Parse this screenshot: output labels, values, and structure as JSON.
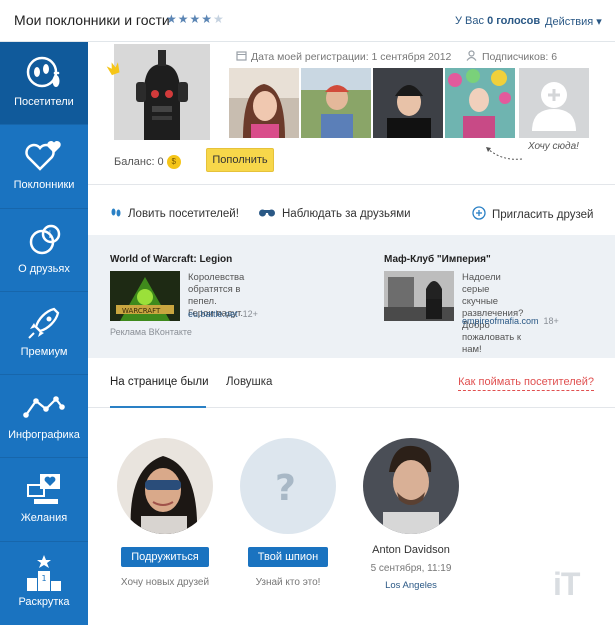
{
  "header": {
    "title": "Мои поклонники и гости",
    "stars_on": "★★★★",
    "stars_off": "★",
    "votes_prefix": "У Вас ",
    "votes_count": "0 голосов",
    "actions": "Действия ▾"
  },
  "sidebar": {
    "items": [
      {
        "label": "Посетители",
        "icon": "footprints-icon"
      },
      {
        "label": "Поклонники",
        "icon": "hearts-icon"
      },
      {
        "label": "О друзьях",
        "icon": "friends-info-icon"
      },
      {
        "label": "Премиум",
        "icon": "rocket-icon"
      },
      {
        "label": "Инфографика",
        "icon": "line-chart-icon"
      },
      {
        "label": "Желания",
        "icon": "wishes-icon"
      },
      {
        "label": "Раскрутка",
        "icon": "podium-icon"
      }
    ]
  },
  "profile": {
    "registration": "Дата моей регистрации: 1 сентября 2012",
    "subscribers": "Подписчиков: 6",
    "balance_label": "Баланс: 0",
    "coin": "$",
    "refill_button": "Пополнить",
    "want_here": "Хочу сюда!"
  },
  "actions_row": {
    "catch": "Ловить посетителей!",
    "watch": "Наблюдать за друзьями",
    "invite": "Пригласить друзей"
  },
  "ads": {
    "ad1": {
      "title": "World of Warcraft: Legion",
      "text1": "Королевства обратятся в пепел.",
      "text2": "Герои падут.",
      "url": "eu.battle.net",
      "age": "12+"
    },
    "ad2": {
      "title": "Маф-Клуб \"Империя\"",
      "text1": "Надоели серые скучные",
      "text2": "развлечения?",
      "text3": "Добро пожаловать к нам!",
      "url": "empireofmafia.com",
      "age": "18+"
    },
    "vk_label": "Реклама ВКонтакте"
  },
  "tabs": {
    "visited": "На странице были",
    "trap": "Ловушка",
    "howto": "Как поймать посетителей?"
  },
  "visitors": {
    "v1": {
      "button": "Подружиться",
      "sub": "Хочу новых друзей"
    },
    "v2": {
      "button": "Твой шпион",
      "sub": "Узнай кто это!"
    },
    "v3": {
      "name": "Anton Davidson",
      "date": "5 сентября, 11:19",
      "city": "Los Angeles"
    }
  },
  "watermark": "iT",
  "colors": {
    "sidebar": "#1a73c0",
    "sidebar_active": "#105a9b",
    "accent_link": "#2a5885",
    "refill_button": "#f7d74a",
    "howto_link": "#e05050"
  }
}
